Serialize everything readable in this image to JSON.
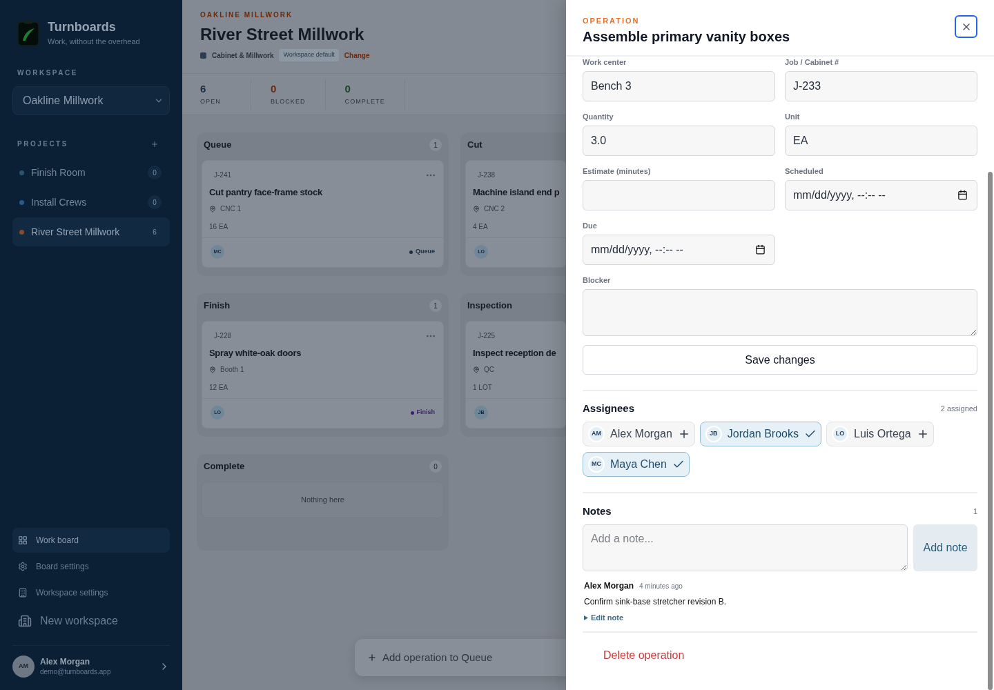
{
  "sidebar": {
    "brand": {
      "name": "Turnboards",
      "tagline": "Work, without the overhead"
    },
    "workspace": {
      "label": "WORKSPACE",
      "value": "Oakline Millwork"
    },
    "projects": {
      "label": "PROJECTS",
      "items": [
        {
          "name": "Finish Room",
          "count": "0",
          "color": "#2e5370",
          "selected": false
        },
        {
          "name": "Install Crews",
          "count": "0",
          "color": "#2a5a88",
          "selected": false
        },
        {
          "name": "River Street Millwork",
          "count": "6",
          "color": "#8a4a28",
          "selected": true
        }
      ]
    },
    "nav": [
      {
        "label": "Work board",
        "kind": "nav",
        "selected": true
      },
      {
        "label": "Board settings",
        "kind": "nav",
        "selected": false
      },
      {
        "label": "Workspace settings",
        "kind": "nav",
        "selected": false
      },
      {
        "label": "New workspace",
        "kind": "action",
        "selected": false
      }
    ],
    "user": {
      "initials": "AM",
      "name": "Alex Morgan",
      "email": "demo@turnboards.app"
    }
  },
  "board": {
    "eyebrow": "OAKLINE MILLWORK",
    "title": "River Street Millwork",
    "template": "Cabinet & Millwork",
    "template_badge": "Workspace default",
    "change_link": "Change",
    "stats": [
      {
        "value": "6",
        "label": "OPEN",
        "color": "#1c2c40"
      },
      {
        "value": "0",
        "label": "BLOCKED",
        "color": "#6b2a0c"
      },
      {
        "value": "0",
        "label": "COMPLETE",
        "color": "#1a4429"
      }
    ],
    "columns": [
      {
        "title": "Queue",
        "count": "1",
        "cards": [
          {
            "job": "J-241",
            "title": "Cut pantry face-frame stock",
            "location": "CNC 1",
            "quantity": "16 EA",
            "assignee": "MC",
            "more_menu": true,
            "stage": {
              "label": "Queue",
              "color": "#1c2c40"
            }
          }
        ]
      },
      {
        "title": "Cut",
        "cards": [
          {
            "job": "J-238",
            "title": "Machine island end p",
            "location": "CNC 2",
            "quantity": "4 EA",
            "assignee": "LO"
          }
        ]
      },
      {
        "title": "Finish",
        "count": "1",
        "cards": [
          {
            "job": "J-228",
            "title": "Spray white-oak doors",
            "location": "Booth 1",
            "quantity": "12 EA",
            "assignee": "LO",
            "more_menu": true,
            "stage": {
              "label": "Finish",
              "color": "#3e1f6b"
            }
          }
        ]
      },
      {
        "title": "Inspection",
        "cards": [
          {
            "job": "J-225",
            "title": "Inspect reception de",
            "location": "QC",
            "quantity": "1 LOT",
            "assignee": "JB"
          }
        ]
      },
      {
        "title": "Complete",
        "count": "0",
        "empty": "Nothing here"
      }
    ],
    "add_button": "Add operation to Queue"
  },
  "panel": {
    "eyebrow": "OPERATION",
    "title": "Assemble primary vanity boxes",
    "fields": [
      {
        "label": "Work center",
        "kind": "text",
        "value": "Bench 3"
      },
      {
        "label": "Job / Cabinet #",
        "kind": "text",
        "value": "J-233"
      },
      {
        "label": "Quantity",
        "kind": "text",
        "value": "3.0"
      },
      {
        "label": "Unit",
        "kind": "text",
        "value": "EA"
      },
      {
        "label": "Estimate (minutes)",
        "kind": "text"
      },
      {
        "label": "Scheduled",
        "kind": "datetime",
        "placeholder": "mm/dd/yyyy, --:-- --"
      },
      {
        "label": "Due",
        "kind": "datetime",
        "placeholder": "mm/dd/yyyy, --:-- --"
      },
      {
        "label": "Blocker",
        "kind": "textarea"
      }
    ],
    "save_button": "Save changes",
    "assignees": {
      "title": "Assignees",
      "summary": "2 assigned",
      "people": [
        {
          "initials": "AM",
          "name": "Alex Morgan",
          "selected": false
        },
        {
          "initials": "JB",
          "name": "Jordan Brooks",
          "selected": true
        },
        {
          "initials": "LO",
          "name": "Luis Ortega",
          "selected": false
        },
        {
          "initials": "MC",
          "name": "Maya Chen",
          "selected": true
        }
      ]
    },
    "notes": {
      "title": "Notes",
      "count": "1",
      "input": {
        "placeholder": "Add a note..."
      },
      "add_button": "Add note",
      "items": [
        {
          "author": "Alex Morgan",
          "time": "4 minutes ago",
          "text": "Confirm sink-base stretcher revision B.",
          "edit": {
            "label": "Edit note",
            "expanded": false
          }
        }
      ]
    },
    "delete_button": "Delete operation"
  }
}
